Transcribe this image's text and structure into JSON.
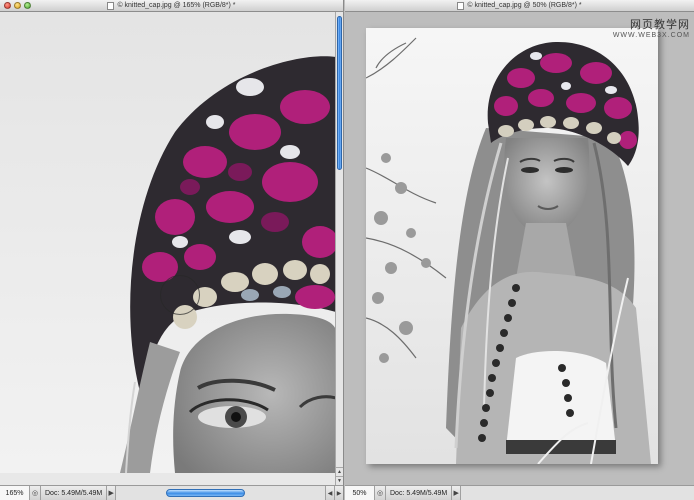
{
  "left_window": {
    "title": "© knitted_cap.jpg @ 165% (RGB/8*) *",
    "zoom": "165%",
    "doc_info": "Doc: 5.49M/5.49M"
  },
  "right_window": {
    "title": "© knitted_cap.jpg @ 50% (RGB/8*) *",
    "zoom": "50%",
    "doc_info": "Doc: 5.49M/5.49M"
  },
  "watermark": {
    "cn": "网页教学网",
    "url": "WWW.WEB3X.COM"
  },
  "colors": {
    "hat_magenta": "#b0207a",
    "scroll_accent": "#3d8ee6"
  }
}
